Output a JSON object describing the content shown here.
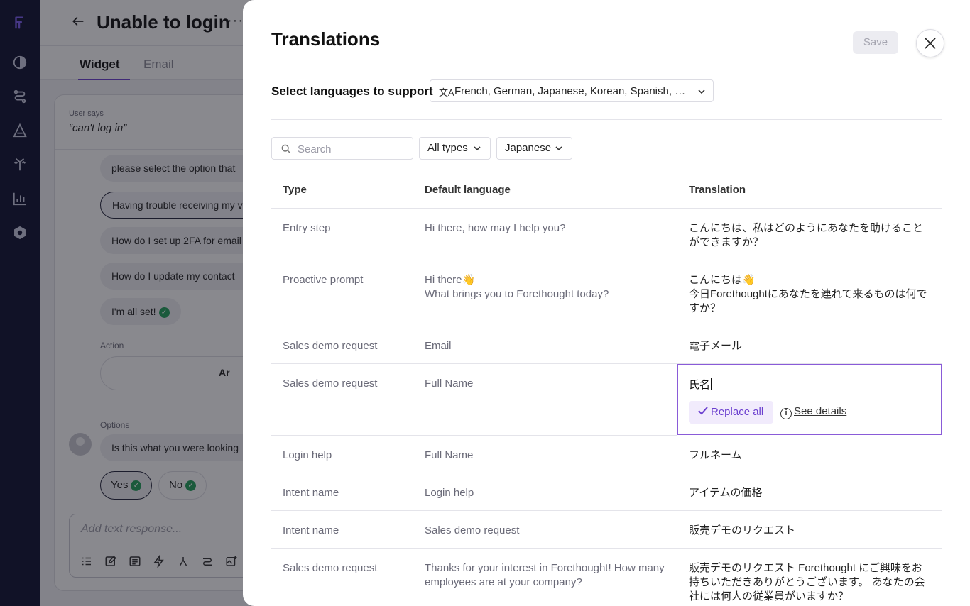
{
  "page": {
    "title": "Unable to login",
    "more_glyph": "···",
    "tabs": [
      {
        "label": "Widget",
        "active": true
      },
      {
        "label": "Email",
        "active": false
      }
    ],
    "user_says_label": "User says",
    "user_quote": "“can't log in”",
    "bubbles": [
      "please select the option that",
      "Having trouble receiving my v",
      "How do I set up 2FA for email",
      "How do I update my contact",
      "I'm all set!"
    ],
    "action_label": "Action",
    "action_button": "Ar",
    "options_label": "Options",
    "options_question": "Is this what you were looking",
    "yes_label": "Yes",
    "no_label": "No",
    "text_placeholder": "Add text response..."
  },
  "drawer": {
    "title": "Translations",
    "save_label": "Save",
    "select_languages_label": "Select languages to support",
    "languages_value": "French, German, Japanese, Korean, Spanish, Sw...",
    "search_placeholder": "Search",
    "type_filter": "All types",
    "language_filter": "Japanese",
    "columns": {
      "type": "Type",
      "default": "Default language",
      "translation": "Translation"
    },
    "rows": [
      {
        "type": "Entry step",
        "default": "Hi there, how may I help you?",
        "translation": "こんにちは、私はどのようにあなたを助けることができますか？"
      },
      {
        "type": "Proactive prompt",
        "default": "Hi there👋\nWhat brings you to Forethought today?",
        "translation": "こんにちは👋\n今日Forethoughtにあなたを連れて来るものは何ですか？"
      },
      {
        "type": "Sales demo request",
        "default": "Email",
        "translation": "電子メール"
      },
      {
        "type": "Sales demo request",
        "default": "Full Name",
        "translation": "氏名"
      },
      {
        "type": "Login help",
        "default": "Full Name",
        "translation": "フルネーム"
      },
      {
        "type": "Intent name",
        "default": "Login help",
        "translation": "アイテムの価格"
      },
      {
        "type": "Intent name",
        "default": "Sales demo request",
        "translation": "販売デモのリクエスト"
      },
      {
        "type": "Sales demo request",
        "default": "Thanks for your interest in Forethought! How many employees are at your company?",
        "translation": "販売デモのリクエスト Forethought にご興味をお持ちいただきありがとうございます。 あなたの会社には何人の従業員がいますか？"
      }
    ],
    "replace_all_label": "Replace all",
    "see_details_label": "See details"
  },
  "colors": {
    "rail": "#0f1130",
    "accent": "#6b3fcf",
    "success": "#22a05a"
  },
  "icons": [
    "forethought-logo-icon",
    "contrast-icon",
    "workflow-icon",
    "triangle-a-icon",
    "branch-arrows-icon",
    "bar-chart-icon",
    "hexagon-settings-icon",
    "back-arrow-icon",
    "close-icon",
    "translate-icon",
    "chevron-down-icon",
    "search-icon",
    "check-icon",
    "info-icon"
  ]
}
